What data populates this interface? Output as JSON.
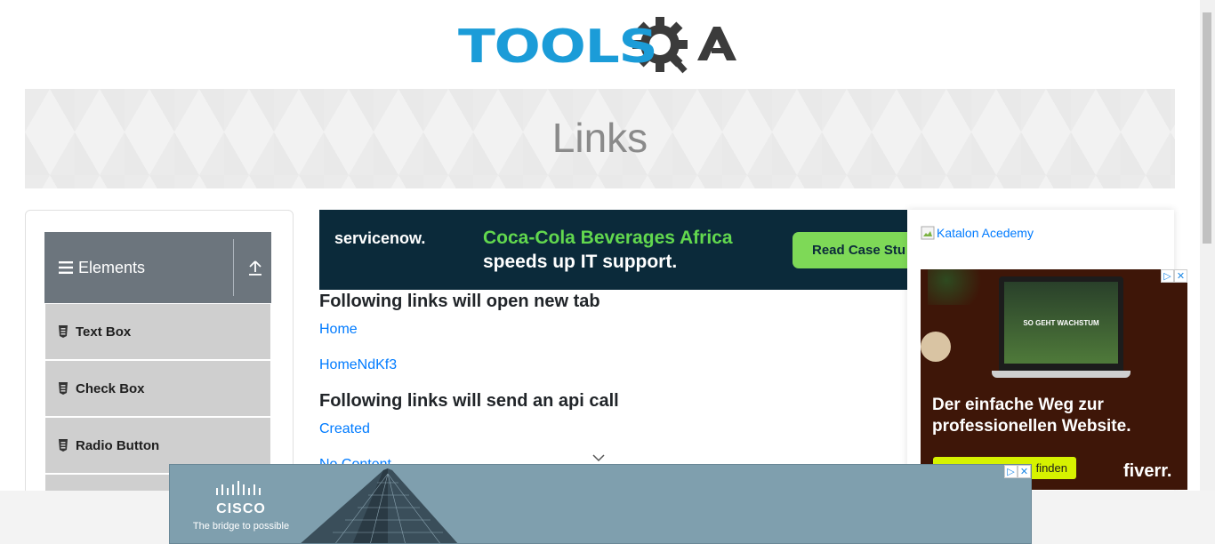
{
  "header": {
    "logo_text": "TOOLS",
    "logo_qa": "QA"
  },
  "banner": {
    "title": "Links"
  },
  "sidebar": {
    "group_title": "Elements",
    "items": [
      {
        "label": "Text Box"
      },
      {
        "label": "Check Box"
      },
      {
        "label": "Radio Button"
      }
    ]
  },
  "ad_top": {
    "brand": "servicenow.",
    "headline1": "Coca-Cola Beverages Africa",
    "headline2": "speeds up IT support.",
    "cta": "Read Case Stu"
  },
  "main": {
    "section1_title": "Following links will open new tab",
    "link_home": "Home",
    "link_dynamic": "HomeNdKf3",
    "section2_title": "Following links will send an api call",
    "link_created": "Created",
    "link_no_content": "No Content"
  },
  "right": {
    "broken_image_alt": "Katalon Acedemy",
    "ad": {
      "screen_text": "SO GEHT WACHSTUM",
      "headline": "Der einfache Weg zur professionellen Website.",
      "cta": "finden",
      "brand": "fiverr."
    }
  },
  "bottom_ad": {
    "brand": "CISCO",
    "tagline": "The bridge to possible"
  },
  "colors": {
    "accent": "#007bff",
    "logo_blue": "#1b9cd8",
    "logo_dark": "#3b3b3b",
    "sidebar_header": "#6c757d"
  }
}
